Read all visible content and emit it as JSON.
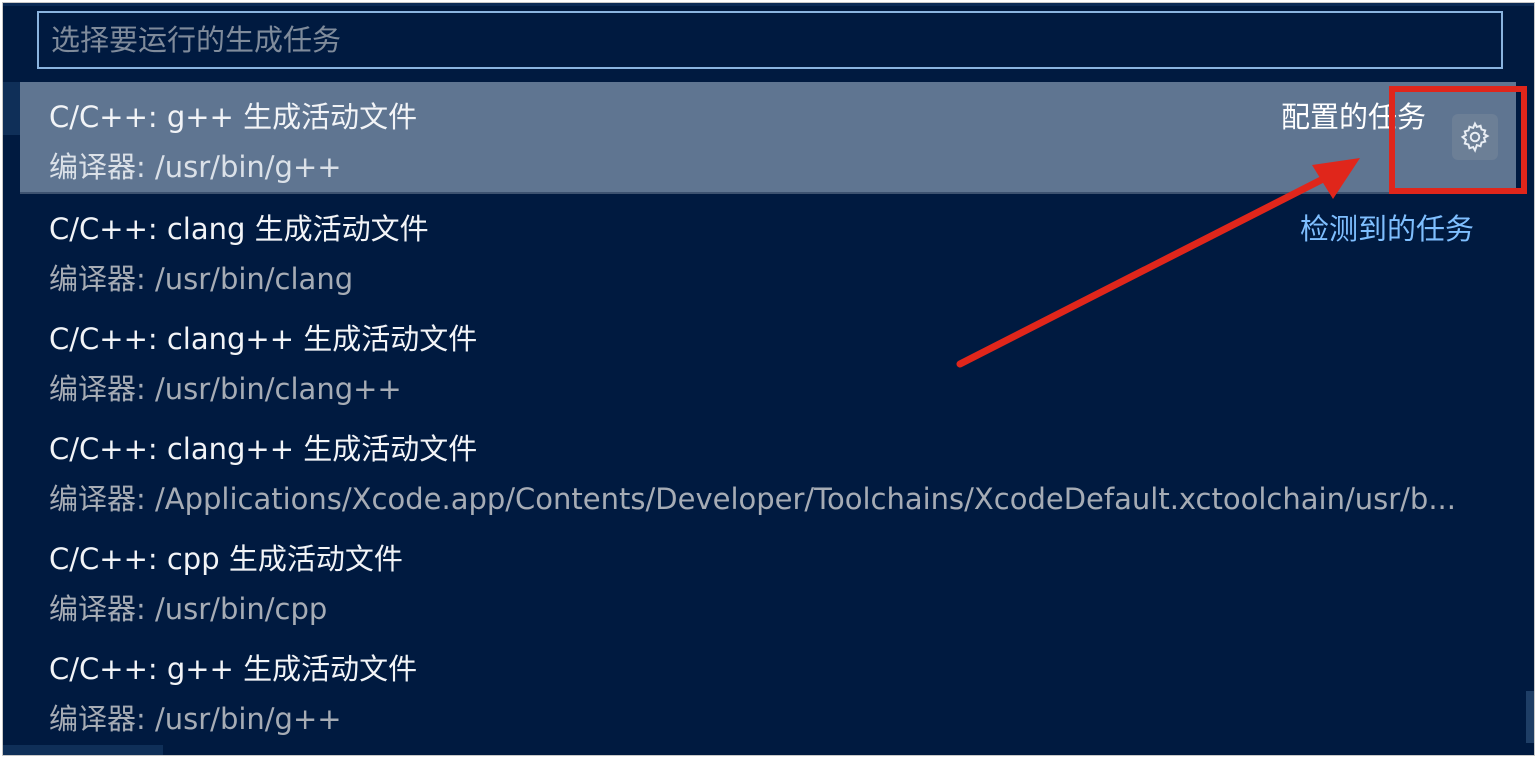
{
  "quick_pick": {
    "placeholder": "选择要运行的生成任务",
    "items": [
      {
        "title": "C/C++: g++ 生成活动文件",
        "detail": "编译器: /usr/bin/g++",
        "group": "配置的任务",
        "selected": true
      },
      {
        "title": "C/C++: clang 生成活动文件",
        "detail": "编译器: /usr/bin/clang",
        "group": "检测到的任务"
      },
      {
        "title": "C/C++: clang++ 生成活动文件",
        "detail": "编译器: /usr/bin/clang++"
      },
      {
        "title": "C/C++: clang++ 生成活动文件",
        "detail": "编译器: /Applications/Xcode.app/Contents/Developer/Toolchains/XcodeDefault.xctoolchain/usr/b..."
      },
      {
        "title": "C/C++: cpp 生成活动文件",
        "detail": "编译器: /usr/bin/cpp"
      },
      {
        "title": "C/C++: g++ 生成活动文件",
        "detail": "编译器: /usr/bin/g++"
      }
    ],
    "configure_icon": "gear-icon"
  },
  "annotation": {
    "color": "#e0261b",
    "arrow_icon": "red-arrow",
    "box": "red-highlight-box"
  },
  "colors": {
    "background": "#001a40",
    "selected_row": "#5f7591",
    "group_label": "#7fbfff"
  }
}
